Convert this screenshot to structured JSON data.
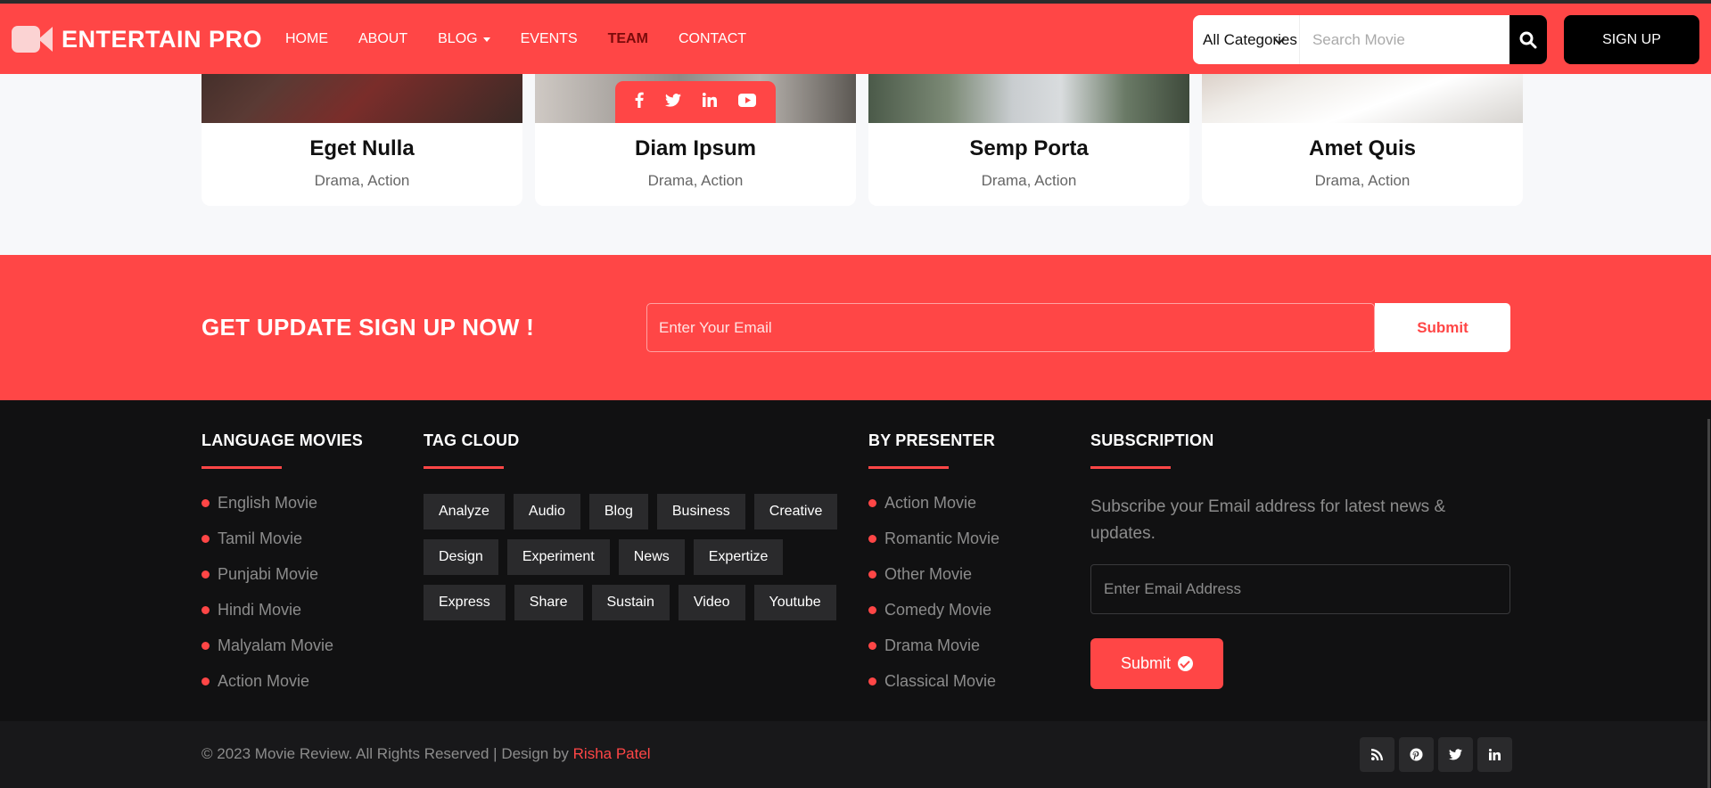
{
  "header": {
    "logo_text": "ENTERTAIN PRO",
    "nav": [
      {
        "label": "HOME"
      },
      {
        "label": "ABOUT"
      },
      {
        "label": "BLOG"
      },
      {
        "label": "EVENTS"
      },
      {
        "label": "TEAM"
      },
      {
        "label": "CONTACT"
      }
    ],
    "active_nav": "TEAM",
    "category_selected": "All Categories",
    "search_placeholder": "Search Movie",
    "signup_label": "SIGN UP"
  },
  "cards": [
    {
      "title": "Eget Nulla",
      "genres": "Drama, Action"
    },
    {
      "title": "Diam Ipsum",
      "genres": "Drama, Action"
    },
    {
      "title": "Semp Porta",
      "genres": "Drama, Action"
    },
    {
      "title": "Amet Quis",
      "genres": "Drama, Action"
    }
  ],
  "newsletter": {
    "title": "GET UPDATE SIGN UP NOW !",
    "placeholder": "Enter Your Email",
    "submit_label": "Submit"
  },
  "footer": {
    "language": {
      "title": "LANGUAGE MOVIES",
      "items": [
        "English Movie",
        "Tamil Movie",
        "Punjabi Movie",
        "Hindi Movie",
        "Malyalam Movie",
        "Action Movie"
      ]
    },
    "tags": {
      "title": "TAG CLOUD",
      "items": [
        "Analyze",
        "Audio",
        "Blog",
        "Business",
        "Creative",
        "Design",
        "Experiment",
        "News",
        "Expertize",
        "Express",
        "Share",
        "Sustain",
        "Video",
        "Youtube"
      ]
    },
    "presenter": {
      "title": "BY PRESENTER",
      "items": [
        "Action Movie",
        "Romantic Movie",
        "Other Movie",
        "Comedy Movie",
        "Drama Movie",
        "Classical Movie"
      ]
    },
    "subscription": {
      "title": "SUBSCRIPTION",
      "text": "Subscribe your Email address for latest news & updates.",
      "placeholder": "Enter Email Address",
      "submit_label": "Submit"
    }
  },
  "bottom": {
    "copyright": "© 2023 Movie Review. All Rights Reserved | Design by ",
    "author": "Risha Patel",
    "social_icons": [
      "rss-icon",
      "pinterest-icon",
      "twitter-icon",
      "linkedin-icon"
    ]
  },
  "colors": {
    "accent": "#ff4646",
    "footer_bg": "#111112",
    "tag_bg": "#2a2a2c"
  }
}
